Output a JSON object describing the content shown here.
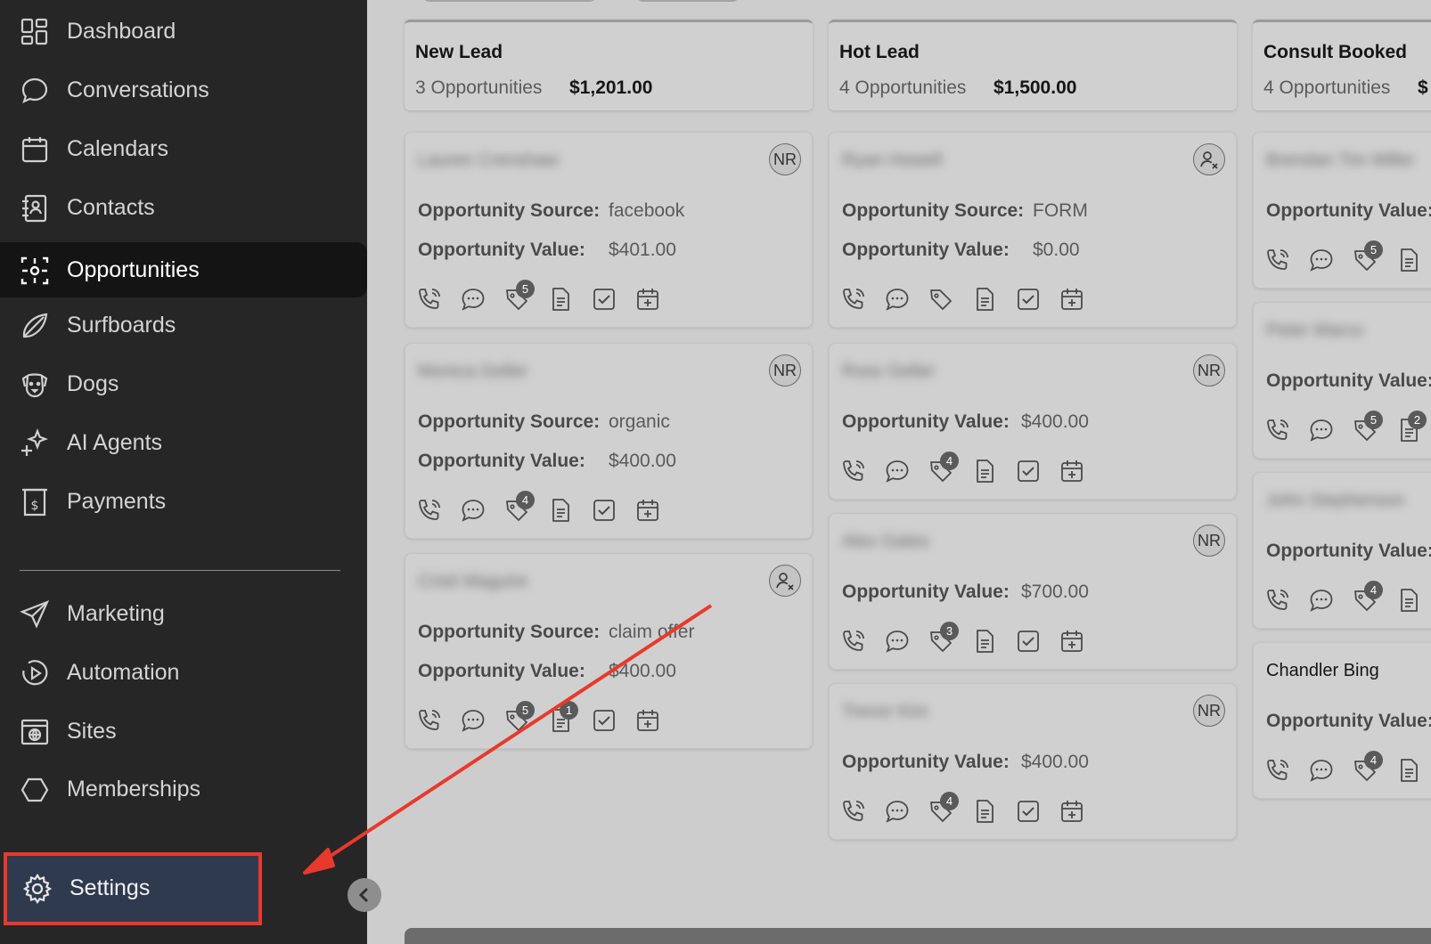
{
  "sidebar": {
    "items": [
      {
        "label": "Dashboard",
        "icon": "dashboard-icon"
      },
      {
        "label": "Conversations",
        "icon": "chat-bubble-icon"
      },
      {
        "label": "Calendars",
        "icon": "calendar-icon"
      },
      {
        "label": "Contacts",
        "icon": "contact-book-icon"
      },
      {
        "label": "Opportunities",
        "icon": "opportunities-icon",
        "active": true
      },
      {
        "label": "Surfboards",
        "icon": "surfboard-icon"
      },
      {
        "label": "Dogs",
        "icon": "dog-icon"
      },
      {
        "label": "AI Agents",
        "icon": "sparkle-icon"
      },
      {
        "label": "Payments",
        "icon": "payments-icon"
      }
    ],
    "bottom_items": [
      {
        "label": "Marketing",
        "icon": "send-icon"
      },
      {
        "label": "Automation",
        "icon": "automation-icon"
      },
      {
        "label": "Sites",
        "icon": "globe-window-icon"
      },
      {
        "label": "Memberships",
        "icon": "membership-icon"
      }
    ],
    "settings": {
      "label": "Settings",
      "icon": "gear-icon"
    }
  },
  "labels": {
    "source": "Opportunity Source:",
    "value": "Opportunity Value:",
    "value_cut": "Opportunity Value:"
  },
  "columns": [
    {
      "title": "New Lead",
      "count": "3 Opportunities",
      "total": "$1,201.00",
      "cards": [
        {
          "name": "Lauren Crenshaw",
          "avatar": "NR",
          "source": "facebook",
          "value": "$401.00",
          "badges": {
            "tag": "5"
          }
        },
        {
          "name": "Monica Geller",
          "avatar": "NR",
          "source": "organic",
          "value": "$400.00",
          "badges": {
            "tag": "4"
          }
        },
        {
          "name": "Cristi Maguire",
          "avatar": "user-x",
          "source": "claim offer",
          "value": "$400.00",
          "badges": {
            "tag": "5",
            "note": "1"
          }
        }
      ]
    },
    {
      "title": "Hot Lead",
      "count": "4 Opportunities",
      "total": "$1,500.00",
      "cards": [
        {
          "name": "Ryan Howell",
          "avatar": "user-x",
          "source": "FORM",
          "value": "$0.00",
          "badges": {}
        },
        {
          "name": "Ross Geller",
          "avatar": "NR",
          "value": "$400.00",
          "badges": {
            "tag": "4"
          }
        },
        {
          "name": "Alex Gates",
          "avatar": "NR",
          "value": "$700.00",
          "badges": {
            "tag": "3"
          }
        },
        {
          "name": "Trevor Kim",
          "avatar": "NR",
          "value": "$400.00",
          "badges": {
            "tag": "4"
          }
        }
      ]
    },
    {
      "title": "Consult Booked",
      "count": "4 Opportunities",
      "total": "$",
      "cards": [
        {
          "name": "Brendan Tim Miller",
          "badges": {
            "tag": "5"
          }
        },
        {
          "name": "Peter Marco",
          "badges": {
            "tag": "5",
            "note": "2"
          }
        },
        {
          "name": "John Stephenson",
          "badges": {
            "tag": "4"
          }
        },
        {
          "name": "Chandler Bing",
          "badges": {
            "tag": "4"
          }
        }
      ]
    }
  ],
  "colors": {
    "sidebar_bg": "#262626",
    "settings_highlight": "#2f3a4f",
    "annotation_red": "#e8392c",
    "board_bg": "#cdcdcd"
  }
}
